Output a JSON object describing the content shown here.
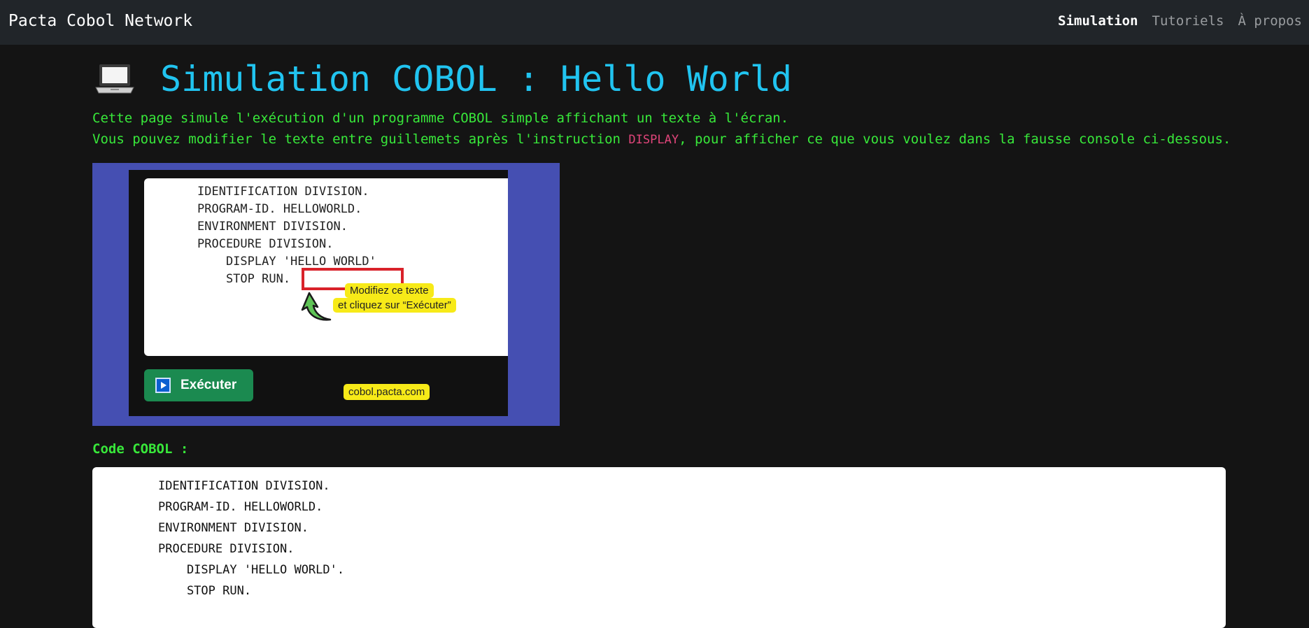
{
  "navbar": {
    "brand": "Pacta Cobol Network",
    "links": [
      "Simulation",
      "Tutoriels",
      "À propos"
    ]
  },
  "page": {
    "icon": "laptop-icon",
    "title": "Simulation COBOL : Hello World",
    "intro_line1": "Cette page simule l'exécution d'un programme COBOL simple affichant un texte à l'écran.",
    "intro_line2_before": "Vous pouvez modifier le texte entre guillemets après l'instruction ",
    "intro_keyword": "DISPLAY",
    "intro_line2_after": ", pour afficher ce que vous voulez dans la fausse console ci-dessous."
  },
  "illustration": {
    "code_lines": [
      "IDENTIFICATION DIVISION.",
      "PROGRAM-ID. HELLOWORLD.",
      "ENVIRONMENT DIVISION.",
      "PROCEDURE DIVISION.",
      "    DISPLAY 'HELLO WORLD'",
      "    STOP RUN."
    ],
    "callout_line1": "Modifiez ce texte",
    "callout_line2": "et cliquez sur “Exécuter”",
    "button_label": "Exécuter",
    "url": "cobol.pacta.com"
  },
  "editor": {
    "label": "Code COBOL :",
    "lines": [
      "IDENTIFICATION DIVISION.",
      "PROGRAM-ID. HELLOWORLD.",
      "ENVIRONMENT DIVISION.",
      "PROCEDURE DIVISION.",
      "    DISPLAY 'HELLO WORLD'.",
      "    STOP RUN."
    ]
  },
  "colors": {
    "title": "#21c4f0",
    "intro_text": "#38e83a",
    "keyword": "#e0457a",
    "navbar_bg": "#212529",
    "page_bg": "#141414",
    "illustration_bg": "#454fb2"
  }
}
